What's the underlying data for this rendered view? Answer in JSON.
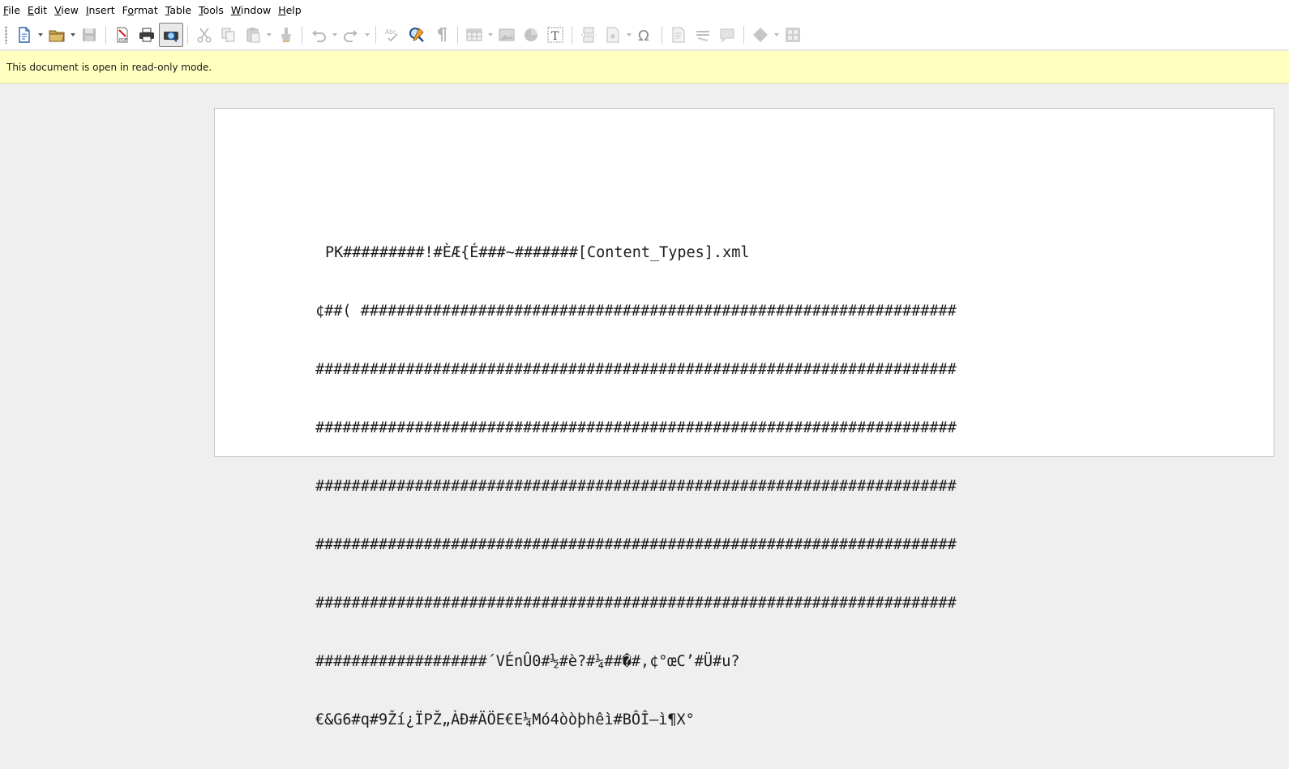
{
  "menubar": {
    "items": [
      {
        "first": "F",
        "rest": "ile"
      },
      {
        "first": "E",
        "rest": "dit"
      },
      {
        "first": "V",
        "rest": "iew"
      },
      {
        "first": "I",
        "rest": "nsert"
      },
      {
        "first": "F",
        "rest": "ormat",
        "underline_index": 1
      },
      {
        "first": "T",
        "rest": "able"
      },
      {
        "first": "T",
        "rest": "ools"
      },
      {
        "first": "W",
        "rest": "indow"
      },
      {
        "first": "H",
        "rest": "elp"
      }
    ]
  },
  "menu_labels": {
    "file": "File",
    "edit": "Edit",
    "view": "View",
    "insert": "Insert",
    "format": "Format",
    "table": "Table",
    "tools": "Tools",
    "window": "Window",
    "help": "Help"
  },
  "infobar": {
    "message": "This document is open in read-only mode.",
    "background": "#ffffc0"
  },
  "document": {
    "lines": [
      "PK#########!#ÈÆ{É###~#######[Content_Types].xml",
      "¢##( ##################################################################",
      "#######################################################################",
      "#######################################################################",
      "#######################################################################",
      "#######################################################################",
      "#######################################################################",
      "###################´VÉnÛ0#½#è?#¼##�#,¢°œC’#Ü#u?",
      "€&G6#q#9Ží¿ÏPŽ„ÀÐ#ÄÖE€E¼Mó4òòþhêì#BÔÎ–ì¶X°"
    ]
  },
  "toolbar": {
    "icons": [
      "new-document-icon",
      "open-folder-icon",
      "save-icon",
      "export-pdf-icon",
      "print-icon",
      "print-preview-icon",
      "cut-icon",
      "copy-icon",
      "paste-icon",
      "clone-formatting-icon",
      "undo-icon",
      "redo-icon",
      "spellcheck-icon",
      "find-replace-icon",
      "formatting-marks-icon",
      "table-icon",
      "image-icon",
      "chart-icon",
      "text-box-icon",
      "page-break-icon",
      "field-icon",
      "special-character-icon",
      "hyperlink-icon",
      "footnote-icon",
      "comment-icon",
      "track-changes-icon",
      "shapes-icon",
      "navigator-icon"
    ]
  }
}
